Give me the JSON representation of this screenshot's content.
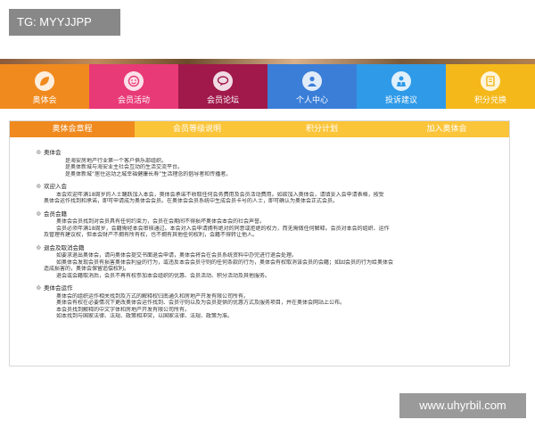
{
  "overlay_label": "TG: MYYJJPP",
  "watermark": "www.uhyrbil.com",
  "nav": [
    {
      "label": "奥体会",
      "icon": "leaf-icon"
    },
    {
      "label": "会员活动",
      "icon": "smile-icon"
    },
    {
      "label": "会员论坛",
      "icon": "chat-bubble-icon"
    },
    {
      "label": "个人中心",
      "icon": "person-icon"
    },
    {
      "label": "投诉建议",
      "icon": "user-tie-icon"
    },
    {
      "label": "积分兑换",
      "icon": "gift-card-icon"
    }
  ],
  "tabs": [
    {
      "label": "奥体会章程",
      "active": true
    },
    {
      "label": "会员等级说明",
      "active": false
    },
    {
      "label": "积分计划",
      "active": false
    },
    {
      "label": "加入奥体会",
      "active": false
    }
  ],
  "sections": [
    {
      "title": "奥体会",
      "lines": [
        {
          "text": "是海安房地产行业第一个客户俱乐部组织。",
          "style": "line"
        },
        {
          "text": "是奥体新城与海安业主社会互动的生活交流平台。",
          "style": "line"
        },
        {
          "text": "是奥体新城“居住运动之城幸福健康长寿”生活理念的倡导者和传播者。",
          "style": "line"
        }
      ]
    },
    {
      "title": "欢迎入会",
      "lines": [
        {
          "text": "本会欢迎年满18周岁的人士踊跃加入本会，奥体会承诺不收取任何会务费用及会员活动费用。如欲加入奥体会，请填妥入会申请表格，按受",
          "style": "line ind"
        },
        {
          "text": "奥体会运作找到和承诺，即可申请成为奥体会会员。在奥体会会员系统中生成会员卡号的人士，即可确认为奥体会正式会员。",
          "style": "line flush"
        }
      ]
    },
    {
      "title": "会员会籍",
      "lines": [
        {
          "text": "奥体会会员找到对会员具有任何约束力，会员在会期间不得损坏奥体会本会的社会声誉。",
          "style": "line ind"
        },
        {
          "text": "会员必须年满18周岁，会籍需经本会审核通过。本会对入会申请拥有绝对的同意或拒绝的权力，而无需做任何解释。会员对本会的组织、运作",
          "style": "line ind"
        },
        {
          "text": "及管理有建议权，但本会财产不拥有所有权，也不拥有其他任何权利，会籍不得转让他人。",
          "style": "line flush"
        }
      ]
    },
    {
      "title": "退会及取消会籍",
      "lines": [
        {
          "text": "如要求退出奥体会，请向奥体会提交书面退会申请，奥体会将会在会员系统资料中办完进行退会处理。",
          "style": "line ind"
        },
        {
          "text": "如奥体会发现会员有损害奥体会利益的行为，或违反本会会员守则的任何条款的行为，奥体会有权取消该会员的会籍；如因会员的行为给奥体会",
          "style": "line ind"
        },
        {
          "text": "造成损害的，奥体会保留追偿权利。",
          "style": "line flush"
        },
        {
          "text": "退会或会籍取消后，会员不再有权参加本会组织的优惠、会员活动、积分活动及其他服务。",
          "style": "line ind"
        }
      ]
    },
    {
      "title": "奥体会运作",
      "lines": [
        {
          "text": "奥体会的组织运作相关找到及方式的解释权归南通久和房地产开发有限公司所有。",
          "style": "line ind"
        },
        {
          "text": "奥体会有权在必要情况下更改奥体会运作找到、会员守则以及为会员提供的优惠方式及服务项目，并在奥体会网站上公布。",
          "style": "line ind"
        },
        {
          "text": "本会员找到解释的中文字体和房地产开发有限公司所有。",
          "style": "line ind"
        },
        {
          "text": "如本找到与国家法律、法规、政策相冲突，以国家法律、法规、政策为准。",
          "style": "line ind"
        }
      ]
    }
  ],
  "colors": {
    "nav": [
      "#f08a1e",
      "#e83a76",
      "#a0194a",
      "#3a7ed8",
      "#2f9ae8",
      "#f4b81a"
    ],
    "tab_active": "#f08a1e",
    "tab_inactive": "#fbc53a"
  }
}
